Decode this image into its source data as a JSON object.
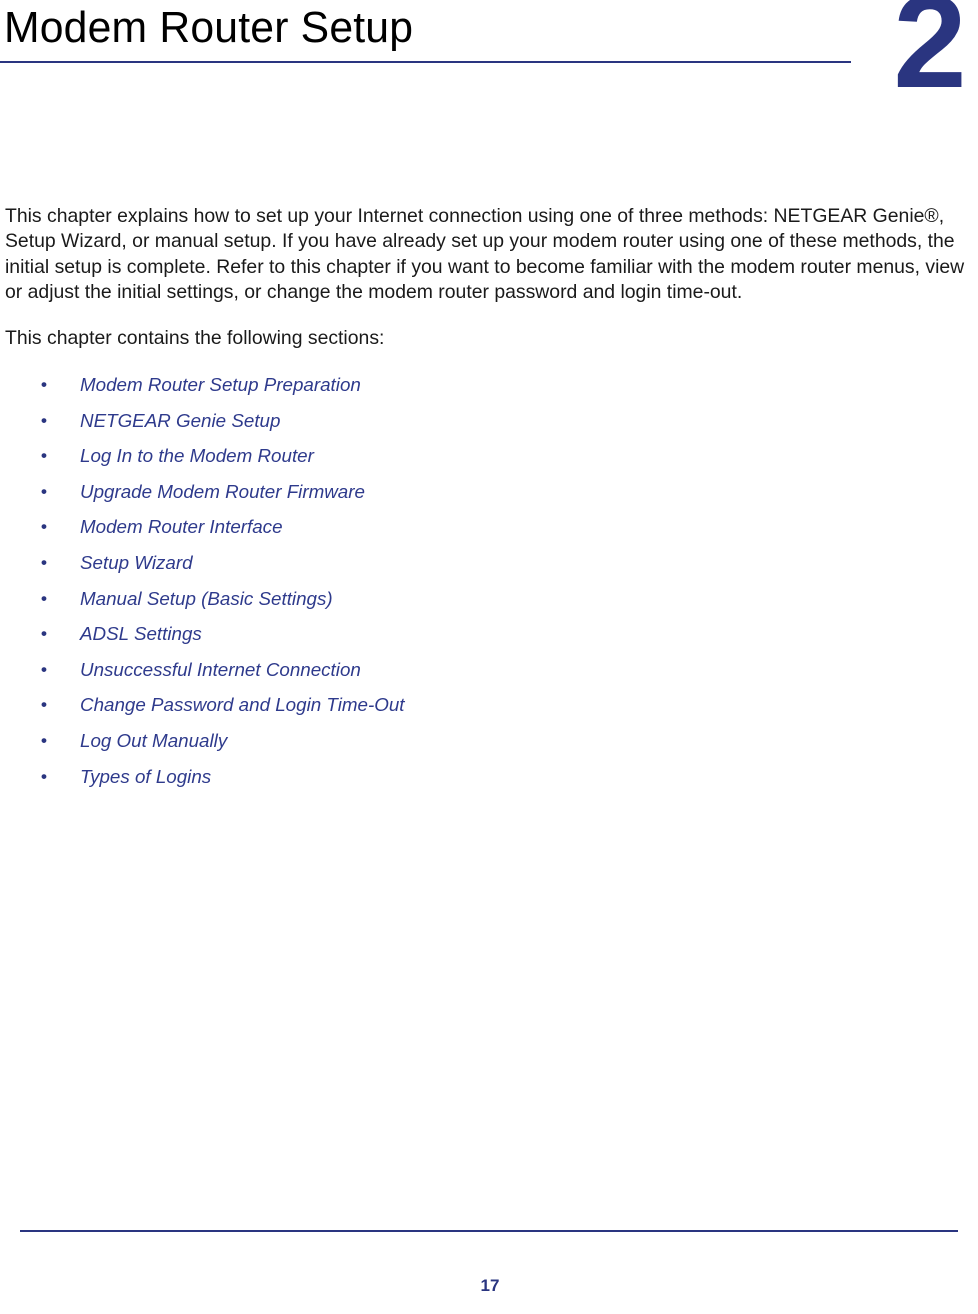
{
  "document": {
    "chapter_title": "Modem Router Setup",
    "chapter_number": "2"
  },
  "body": {
    "intro_paragraph": "This chapter explains how to set up your Internet connection using one of three methods: NETGEAR Genie®, Setup Wizard, or manual setup. If you have already set up your modem router using one of these methods, the initial setup is complete. Refer to this chapter if you want to become familiar with the modem router menus, view or adjust the initial settings, or change the modem router password and login time-out.",
    "sections_lead": "This chapter contains the following sections:",
    "bullet_glyph": "•",
    "sections": [
      {
        "label": "Modem Router Setup Preparation"
      },
      {
        "label": "NETGEAR Genie Setup"
      },
      {
        "label": "Log In to the Modem Router"
      },
      {
        "label": "Upgrade Modem Router Firmware"
      },
      {
        "label": "Modem Router Interface"
      },
      {
        "label": "Setup Wizard"
      },
      {
        "label": "Manual Setup (Basic Settings)"
      },
      {
        "label": "ADSL Settings"
      },
      {
        "label": "Unsuccessful Internet Connection"
      },
      {
        "label": "Change Password and Login Time-Out"
      },
      {
        "label": "Log Out Manually"
      },
      {
        "label": "Types of Logins"
      }
    ]
  },
  "footer": {
    "page_number": "17"
  },
  "colors": {
    "accent_navy": "#2a3580",
    "link_navy": "#2e3a8c",
    "body_text": "#1a1a1a"
  }
}
